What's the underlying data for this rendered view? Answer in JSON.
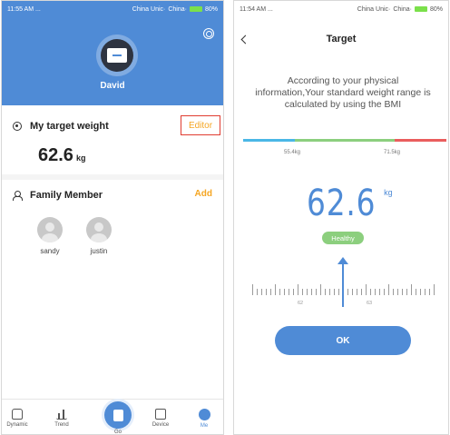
{
  "left": {
    "status": {
      "time": "11:55 AM",
      "extra": "...",
      "carrier1": "China Unic·",
      "carrier2": "China·",
      "battery": "80%"
    },
    "user": {
      "name": "David"
    },
    "target": {
      "title": "My target weight",
      "editor_label": "Editor",
      "value": "62.6",
      "unit": "kg"
    },
    "family": {
      "title": "Family Member",
      "add_label": "Add",
      "members": [
        {
          "name": "sandy"
        },
        {
          "name": "justin"
        }
      ]
    },
    "tabs": [
      {
        "label": "Dynamic"
      },
      {
        "label": "Trend"
      },
      {
        "label": "Go"
      },
      {
        "label": "Device"
      },
      {
        "label": "Me"
      }
    ],
    "colors": {
      "primary": "#4f8bd6",
      "accent": "#f5a623",
      "highlight": "#e03c31"
    }
  },
  "right": {
    "status": {
      "time": "11:54 AM",
      "extra": "...",
      "carrier1": "China Unic·",
      "carrier2": "China·",
      "battery": "80%"
    },
    "title": "Target",
    "description": "According to your physical information,Your standard weight range is calculated by using the BMI",
    "range": {
      "low": "55.4kg",
      "high": "71.5kg"
    },
    "value": "62.6",
    "unit": "kg",
    "status_badge": "Healthy",
    "ruler_labels": [
      "62",
      "63"
    ],
    "ok_label": "OK",
    "colors": {
      "under": "#4ab7e6",
      "healthy": "#8ccf7e",
      "over": "#ea5d5d"
    }
  }
}
